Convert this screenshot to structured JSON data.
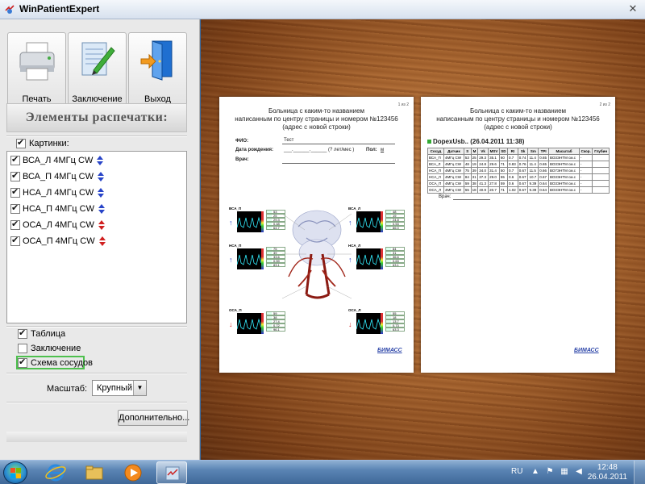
{
  "window": {
    "title": "WinPatientExpert"
  },
  "toolbar": {
    "print_label": "Печать",
    "conclusion_label": "Заключение",
    "exit_label": "Выход"
  },
  "left_panel": {
    "section_title": "Элементы распечатки:",
    "pictures_label": "Картинки:",
    "pictures_checked": true,
    "items": [
      {
        "label": "ВСА_Л 4МГц CW",
        "checked": true,
        "icon": "blue-arrows-icon"
      },
      {
        "label": "ВСА_П 4МГц CW",
        "checked": true,
        "icon": "blue-arrows-icon"
      },
      {
        "label": "НСА_Л 4МГц CW",
        "checked": true,
        "icon": "blue-arrows-icon"
      },
      {
        "label": "НСА_П 4МГц CW",
        "checked": true,
        "icon": "blue-arrows-icon"
      },
      {
        "label": "ОСА_Л 4МГц CW",
        "checked": true,
        "icon": "red-arrows-icon"
      },
      {
        "label": "ОСА_П 4МГц CW",
        "checked": true,
        "icon": "red-arrows-icon"
      }
    ],
    "table_label": "Таблица",
    "table_checked": true,
    "conclusion_label": "Заключение",
    "conclusion_checked": false,
    "scheme_label": "Схема сосудов",
    "scheme_checked": true,
    "scale_label": "Масштаб:",
    "scale_value": "Крупный",
    "more_button": "Дополнительно..."
  },
  "preview": {
    "page1": {
      "page_no": "1 из 2",
      "hospital_line1": "Больница с каким-то названием",
      "hospital_line2": "написанным по центру страницы и номером  №123456",
      "hospital_line3": "(адрес с новой строки)",
      "fio_label": "ФИО:",
      "fio_value": "Тест",
      "dob_label": "Дата рождения:",
      "dob_value": "___.______.______ (? лет/мес )",
      "sex_label": "Пол:",
      "sex_value": "м",
      "doctor_label": "Врач:",
      "logo": "БИМАСС",
      "panels": [
        {
          "name": "ВСА_П",
          "vals": [
            "53",
            "25",
            "29.3",
            "0.48",
            "64.7"
          ]
        },
        {
          "name": "ВСА_Л",
          "vals": [
            "48",
            "19",
            "24.8",
            "0.53",
            "86.0"
          ]
        },
        {
          "name": "НСА_П",
          "vals": [
            "75",
            "39",
            "33.6",
            "0.59",
            "83.1"
          ]
        },
        {
          "name": "НСА_Л",
          "vals": [
            "84",
            "31",
            "36.6",
            "0.63",
            "63.1"
          ]
        },
        {
          "name": "ОСА_П",
          "vals": [
            "59",
            "38",
            "27.4",
            "0.72",
            "96.1"
          ]
        },
        {
          "name": "ОСА_Л",
          "vals": [
            "55",
            "18",
            "13.7",
            "0.73",
            "63.3"
          ]
        }
      ]
    },
    "page2": {
      "page_no": "2 из 2",
      "hospital_line1": "Больница с каким-то названием",
      "hospital_line2": "написанным по центру страницы и номером  №123456",
      "hospital_line3": "(адрес с новой строки)",
      "study_title": "DopexUsb.. (26.04.2011 11:38)",
      "doctor_label": "Врач:",
      "logo": "БИМАСС",
      "table_headers": [
        "Сосуд",
        "Датчик",
        "S",
        "M",
        "Vk",
        "MSV",
        "SD",
        "RI",
        "Sk",
        "Sm",
        "TPI",
        "Масштаб",
        "Скор.",
        "Глубин"
      ],
      "table_rows": [
        [
          "ВСА_П",
          "4МГц CW",
          "53",
          "25",
          "29.3",
          "35.1",
          "60",
          "0.7",
          "0.74",
          "11.4",
          "0.65",
          "ВО3ЭНТМ см.с",
          "-",
          ""
        ],
        [
          "ВСА_Л",
          "4МГц CW",
          "48",
          "19",
          "24.8",
          "29.6",
          "71",
          "0.83",
          "0.76",
          "11.4",
          "0.65",
          "ВО3ЭНТМ см.с",
          "-",
          ""
        ],
        [
          "НСА_П",
          "4МГц CW",
          "75",
          "39",
          "34.0",
          "31.4",
          "50",
          "0.7",
          "0.67",
          "11.5",
          "0.66",
          "ВО7ЭНТМ см.с",
          "-",
          ""
        ],
        [
          "НСА_Л",
          "4МГц CW",
          "84",
          "31",
          "37.3",
          "29.0",
          "55",
          "0.6",
          "0.67",
          "10.7",
          "0.67",
          "ВО3ЭНТМ см.с",
          "-",
          ""
        ],
        [
          "ОСА_П",
          "4МГц CW",
          "59",
          "38",
          "41.3",
          "27.8",
          "59",
          "0.6",
          "0.67",
          "9.39",
          "0.64",
          "ВО3ЭНТМ см.с",
          "-",
          ""
        ],
        [
          "ОСА_Л",
          "4МГц CW",
          "55",
          "18",
          "40.9",
          "20.7",
          "71",
          "1.02",
          "0.67",
          "9.39",
          "0.64",
          "ВО3ЭНТМ см.с",
          "-",
          ""
        ]
      ]
    }
  },
  "taskbar": {
    "lang": "RU",
    "time": "12:48",
    "date": "26.04.2011"
  }
}
